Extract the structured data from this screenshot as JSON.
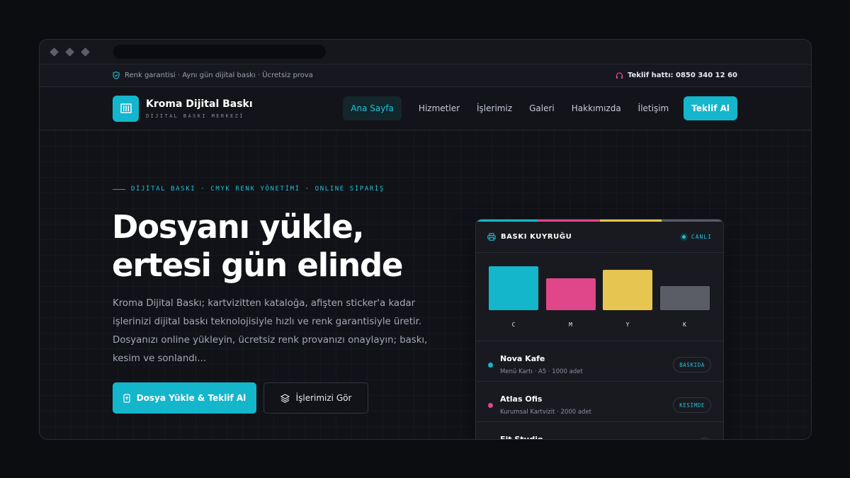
{
  "topbar": {
    "info": "Renk garantisi · Aynı gün dijital baskı · Ücretsiz prova",
    "hotline": "Teklif hattı: 0850 340 12 60"
  },
  "brand": {
    "name": "Kroma Dijital Baskı",
    "tagline": "DİJİTAL BASKI MERKEZİ"
  },
  "nav": {
    "items": [
      "Ana Sayfa",
      "Hizmetler",
      "İşlerimiz",
      "Galeri",
      "Hakkımızda",
      "İletişim"
    ],
    "active": "Ana Sayfa",
    "cta": "Teklif Al"
  },
  "hero": {
    "eyebrow": "DİJİTAL BASKI · CMYK RENK YÖNETİMİ · ONLINE SİPARİŞ",
    "title_line1": "Dosyanı yükle,",
    "title_line2": "ertesi gün elinde",
    "lead": "Kroma Dijital Baskı; kartvizitten kataloğa, afişten sticker'a kadar işlerinizi dijital baskı teknolojisiyle hızlı ve renk garantisiyle üretir. Dosyanızı online yükleyin, ücretsiz renk provanızı onaylayın; baskı, kesim ve sonlandı...",
    "primary_button": "Dosya Yükle & Teklif Al",
    "secondary_button": "İşlerimizi Gör"
  },
  "queue": {
    "title": "BASKI KUYRUĞU",
    "live": "CANLI",
    "channels": [
      {
        "label": "C",
        "level": 0.76,
        "color": "#14b6cc"
      },
      {
        "label": "M",
        "level": 0.55,
        "color": "#e0468a"
      },
      {
        "label": "Y",
        "level": 0.69,
        "color": "#e6c650"
      },
      {
        "label": "K",
        "level": 0.41,
        "color": "#5a5d66"
      }
    ],
    "jobs": [
      {
        "name": "Nova Kafe",
        "desc": "Menü Kartı · A5 · 1000 adet",
        "status": "BASKIDA",
        "color": "#14b6cc"
      },
      {
        "name": "Atlas Ofis",
        "desc": "Kurumsal Kartvizit · 2000 adet",
        "status": "KESİMDE",
        "color": "#e0468a"
      },
      {
        "name": "Fit Studio",
        "desc": "",
        "status": "",
        "color": "#e6c650"
      }
    ]
  },
  "colors": {
    "accent": "#14b6cc",
    "magenta": "#e0468a",
    "yellow": "#e6c650",
    "background": "#111217"
  }
}
